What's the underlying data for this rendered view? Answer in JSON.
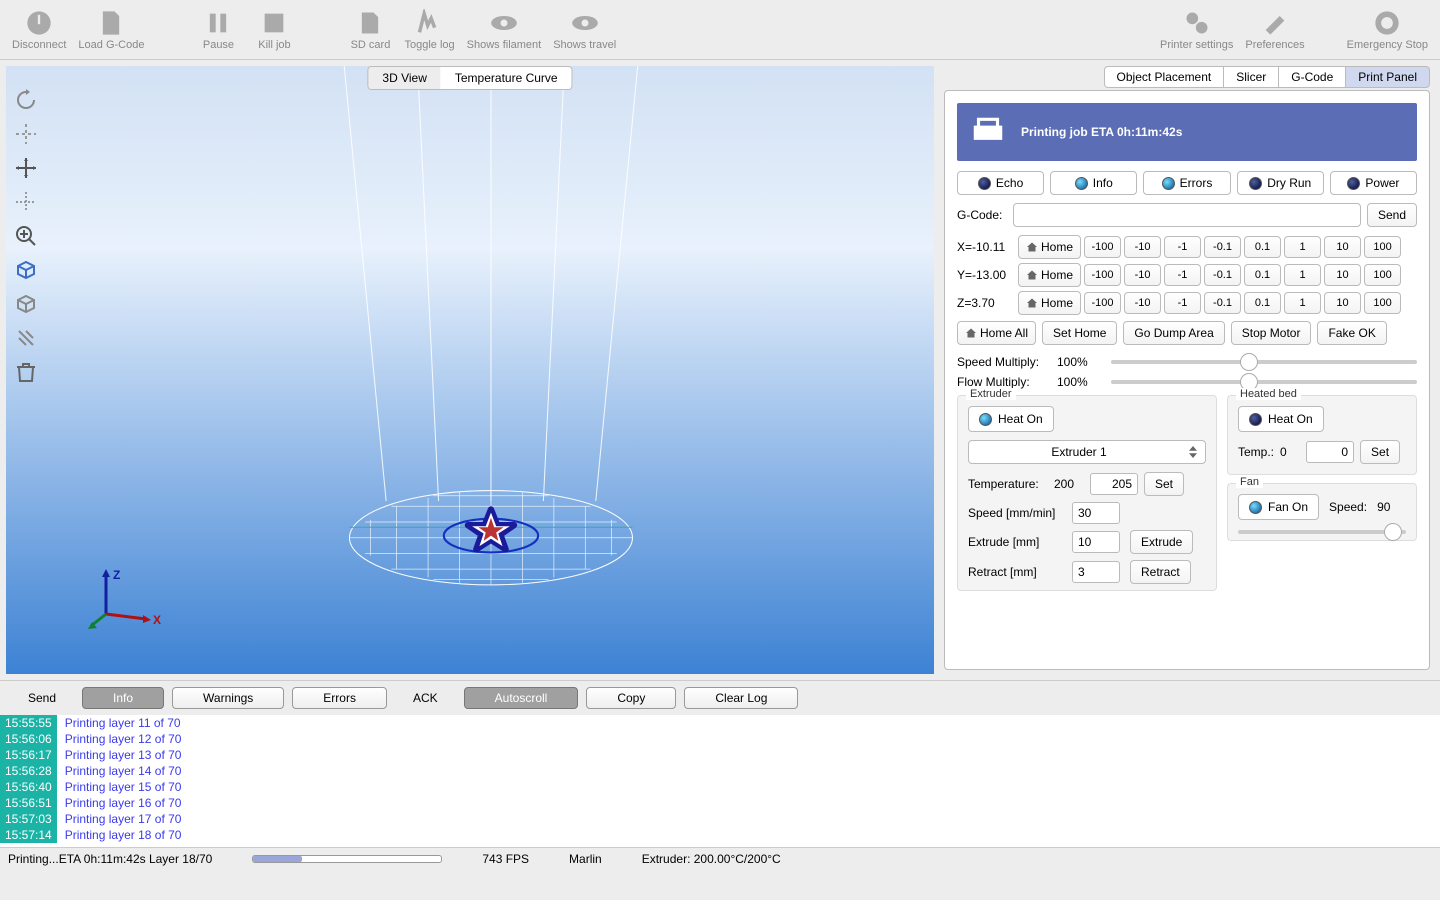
{
  "toolbar": [
    {
      "name": "disconnect",
      "label": "Disconnect"
    },
    {
      "name": "load-gcode",
      "label": "Load G-Code"
    },
    {
      "name": "pause",
      "label": "Pause"
    },
    {
      "name": "kill-job",
      "label": "Kill job"
    },
    {
      "name": "sd-card",
      "label": "SD card"
    },
    {
      "name": "toggle-log",
      "label": "Toggle log"
    },
    {
      "name": "shows-filament",
      "label": "Shows filament"
    },
    {
      "name": "shows-travel",
      "label": "Shows travel"
    },
    {
      "name": "printer-settings",
      "label": "Printer settings"
    },
    {
      "name": "preferences",
      "label": "Preferences"
    },
    {
      "name": "emergency",
      "label": "Emergency Stop"
    }
  ],
  "view_tabs": {
    "v3d": "3D View",
    "temp": "Temperature Curve"
  },
  "right_tabs": [
    "Object Placement",
    "Slicer",
    "G-Code",
    "Print Panel"
  ],
  "eta": "Printing job ETA 0h:11m:42s",
  "msg_toggles": [
    "Echo",
    "Info",
    "Errors",
    "Dry Run",
    "Power"
  ],
  "gcode_label": "G-Code:",
  "send": "Send",
  "axes": [
    {
      "label": "X=-10.11"
    },
    {
      "label": "Y=-13.00"
    },
    {
      "label": "Z=3.70"
    }
  ],
  "home": "Home",
  "steps": [
    "-100",
    "-10",
    "-1",
    "-0.1",
    "0.1",
    "1",
    "10",
    "100"
  ],
  "actions": [
    "Home All",
    "Set Home",
    "Go Dump Area",
    "Stop Motor",
    "Fake OK"
  ],
  "speed_multiply": {
    "label": "Speed Multiply:",
    "val": "100%"
  },
  "flow_multiply": {
    "label": "Flow Multiply:",
    "val": "100%"
  },
  "extruder": {
    "title": "Extruder",
    "heat_on": "Heat On",
    "selected": "Extruder 1",
    "temp_label": "Temperature:",
    "temp_cur": "200",
    "temp_set": "205",
    "set": "Set",
    "speed_label": "Speed [mm/min]",
    "speed": "30",
    "extrude_label": "Extrude [mm]",
    "extrude_val": "10",
    "extrude_btn": "Extrude",
    "retract_label": "Retract [mm]",
    "retract_val": "3",
    "retract_btn": "Retract"
  },
  "heated_bed": {
    "title": "Heated bed",
    "heat_on": "Heat On",
    "temp_label": "Temp.:",
    "cur": "0",
    "set_val": "0",
    "set": "Set"
  },
  "fan": {
    "title": "Fan",
    "fan_on": "Fan On",
    "speed_label": "Speed:",
    "speed": "90"
  },
  "log_filters": {
    "send": "Send",
    "info": "Info",
    "warnings": "Warnings",
    "errors": "Errors",
    "ack": "ACK",
    "autoscroll": "Autoscroll",
    "copy": "Copy",
    "clear": "Clear Log"
  },
  "log": [
    {
      "ts": "15:55:55",
      "msg": "Printing layer 11 of 70"
    },
    {
      "ts": "15:56:06",
      "msg": "Printing layer 12 of 70"
    },
    {
      "ts": "15:56:17",
      "msg": "Printing layer 13 of 70"
    },
    {
      "ts": "15:56:28",
      "msg": "Printing layer 14 of 70"
    },
    {
      "ts": "15:56:40",
      "msg": "Printing layer 15 of 70"
    },
    {
      "ts": "15:56:51",
      "msg": "Printing layer 16 of 70"
    },
    {
      "ts": "15:57:03",
      "msg": "Printing layer 17 of 70"
    },
    {
      "ts": "15:57:14",
      "msg": "Printing layer 18 of 70"
    }
  ],
  "status": {
    "left": "Printing...ETA 0h:11m:42s Layer 18/70",
    "fps": "743 FPS",
    "fw": "Marlin",
    "extruder": "Extruder: 200.00°C/200°C",
    "progress_pct": 26
  }
}
